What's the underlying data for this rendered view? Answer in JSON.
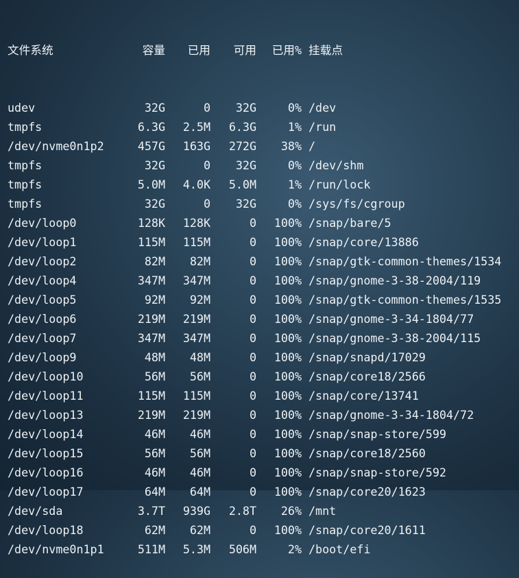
{
  "header": {
    "filesystem": "文件系统",
    "size": "容量",
    "used": "已用",
    "available": "可用",
    "use_pct": "已用%",
    "mounted_on": "挂载点"
  },
  "rows": [
    {
      "fs": "udev",
      "size": "32G",
      "used": "0",
      "avail": "32G",
      "pct": "0%",
      "mount": "/dev"
    },
    {
      "fs": "tmpfs",
      "size": "6.3G",
      "used": "2.5M",
      "avail": "6.3G",
      "pct": "1%",
      "mount": "/run"
    },
    {
      "fs": "/dev/nvme0n1p2",
      "size": "457G",
      "used": "163G",
      "avail": "272G",
      "pct": "38%",
      "mount": "/"
    },
    {
      "fs": "tmpfs",
      "size": "32G",
      "used": "0",
      "avail": "32G",
      "pct": "0%",
      "mount": "/dev/shm"
    },
    {
      "fs": "tmpfs",
      "size": "5.0M",
      "used": "4.0K",
      "avail": "5.0M",
      "pct": "1%",
      "mount": "/run/lock"
    },
    {
      "fs": "tmpfs",
      "size": "32G",
      "used": "0",
      "avail": "32G",
      "pct": "0%",
      "mount": "/sys/fs/cgroup"
    },
    {
      "fs": "/dev/loop0",
      "size": "128K",
      "used": "128K",
      "avail": "0",
      "pct": "100%",
      "mount": "/snap/bare/5"
    },
    {
      "fs": "/dev/loop1",
      "size": "115M",
      "used": "115M",
      "avail": "0",
      "pct": "100%",
      "mount": "/snap/core/13886"
    },
    {
      "fs": "/dev/loop2",
      "size": "82M",
      "used": "82M",
      "avail": "0",
      "pct": "100%",
      "mount": "/snap/gtk-common-themes/1534"
    },
    {
      "fs": "/dev/loop4",
      "size": "347M",
      "used": "347M",
      "avail": "0",
      "pct": "100%",
      "mount": "/snap/gnome-3-38-2004/119"
    },
    {
      "fs": "/dev/loop5",
      "size": "92M",
      "used": "92M",
      "avail": "0",
      "pct": "100%",
      "mount": "/snap/gtk-common-themes/1535"
    },
    {
      "fs": "/dev/loop6",
      "size": "219M",
      "used": "219M",
      "avail": "0",
      "pct": "100%",
      "mount": "/snap/gnome-3-34-1804/77"
    },
    {
      "fs": "/dev/loop7",
      "size": "347M",
      "used": "347M",
      "avail": "0",
      "pct": "100%",
      "mount": "/snap/gnome-3-38-2004/115"
    },
    {
      "fs": "/dev/loop9",
      "size": "48M",
      "used": "48M",
      "avail": "0",
      "pct": "100%",
      "mount": "/snap/snapd/17029"
    },
    {
      "fs": "/dev/loop10",
      "size": "56M",
      "used": "56M",
      "avail": "0",
      "pct": "100%",
      "mount": "/snap/core18/2566"
    },
    {
      "fs": "/dev/loop11",
      "size": "115M",
      "used": "115M",
      "avail": "0",
      "pct": "100%",
      "mount": "/snap/core/13741"
    },
    {
      "fs": "/dev/loop13",
      "size": "219M",
      "used": "219M",
      "avail": "0",
      "pct": "100%",
      "mount": "/snap/gnome-3-34-1804/72"
    },
    {
      "fs": "/dev/loop14",
      "size": "46M",
      "used": "46M",
      "avail": "0",
      "pct": "100%",
      "mount": "/snap/snap-store/599"
    },
    {
      "fs": "/dev/loop15",
      "size": "56M",
      "used": "56M",
      "avail": "0",
      "pct": "100%",
      "mount": "/snap/core18/2560"
    },
    {
      "fs": "/dev/loop16",
      "size": "46M",
      "used": "46M",
      "avail": "0",
      "pct": "100%",
      "mount": "/snap/snap-store/592"
    },
    {
      "fs": "/dev/loop17",
      "size": "64M",
      "used": "64M",
      "avail": "0",
      "pct": "100%",
      "mount": "/snap/core20/1623"
    },
    {
      "fs": "/dev/sda",
      "size": "3.7T",
      "used": "939G",
      "avail": "2.8T",
      "pct": "26%",
      "mount": "/mnt"
    },
    {
      "fs": "/dev/loop18",
      "size": "62M",
      "used": "62M",
      "avail": "0",
      "pct": "100%",
      "mount": "/snap/core20/1611"
    },
    {
      "fs": "/dev/nvme0n1p1",
      "size": "511M",
      "used": "5.3M",
      "avail": "506M",
      "pct": "2%",
      "mount": "/boot/efi"
    }
  ]
}
